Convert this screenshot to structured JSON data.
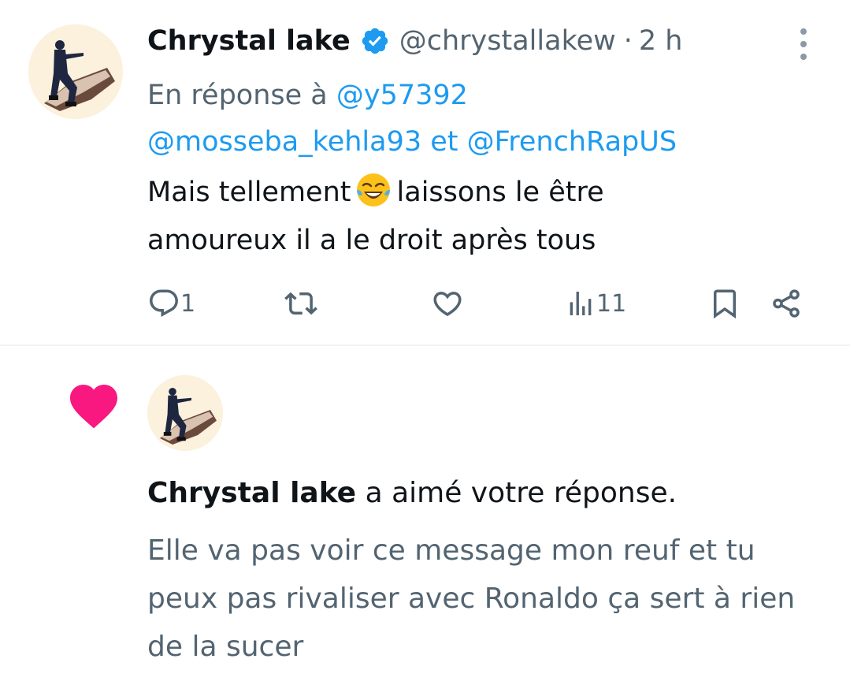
{
  "tweet": {
    "author_name": "Chrystal lake",
    "author_handle": "@chrystallakew",
    "separator": "·",
    "time": "2 h",
    "reply_prefix": "En réponse à",
    "mention_1": "@y57392",
    "mention_2": "@mosseba_kehla93",
    "mention_joiner": "et",
    "mention_3": "@FrenchRapUS",
    "text_before_emoji": "Mais tellement",
    "emoji": "face-with-tears-of-joy",
    "text_after_emoji": "laissons le être",
    "text_line_2": "amoureux il a le droit après tous",
    "reply_count": "1",
    "view_count": "11",
    "icons": [
      "verified-badge-icon",
      "more-icon",
      "reply-icon",
      "retweet-icon",
      "like-icon",
      "views-icon",
      "bookmark-icon",
      "share-icon"
    ]
  },
  "notification": {
    "actor_name": "Chrystal lake",
    "action_text": "a aimé votre réponse.",
    "quoted_text": "Elle va pas voir ce message mon reuf et tu peux pas rivaliser avec Ronaldo ça sert à rien de la sucer",
    "icon": "heart-icon"
  },
  "colors": {
    "text": "#0f1419",
    "secondary": "#536471",
    "link": "#1d9bf0",
    "heart": "#f91880",
    "divider": "#eff3f4"
  }
}
